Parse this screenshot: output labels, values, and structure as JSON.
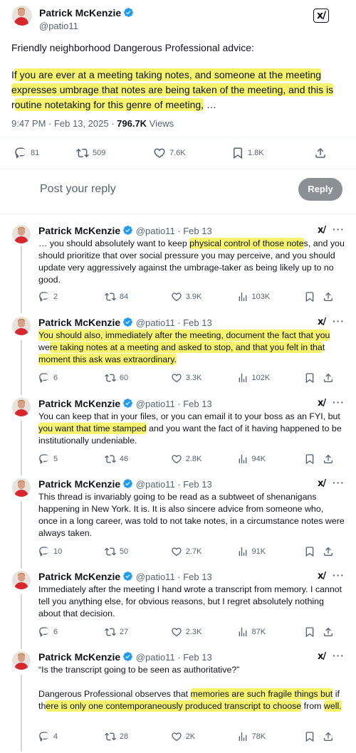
{
  "main": {
    "name": "Patrick McKenzie",
    "handle": "@patio11",
    "paragraph1": "Friendly neighborhood Dangerous Professional advice:",
    "p2_pre": "I",
    "p2_hl1": "f you are ever at a meeting taking notes, and someone at the meeting",
    "p2_hl2": "expresses umbrage that notes are being taken of the meeting, and this is",
    "p2_mid": "r",
    "p2_hl3": "outine notetaking for this genre of meeting,",
    "p2_post": " …",
    "time": "9:47 PM · Feb 13, 2025 · ",
    "views_count": "796.7K",
    "views_label": " Views",
    "stats": {
      "replies": "81",
      "reposts": "509",
      "likes": "7.6K",
      "bookmarks": "1.8K"
    }
  },
  "reply_box": {
    "prompt": "Post your reply",
    "button": "Reply"
  },
  "replies": [
    {
      "name": "Patrick McKenzie",
      "handle": "@patio11",
      "date": " · Feb 13",
      "t1": "… you should absolutely want to keep ",
      "h1": "physical control of those note",
      "t2": "s, and you should prioritize that over social pressure you may perceive, and you should update very aggressively against the umbrage-taker as being likely up to no good.",
      "replies": "2",
      "reposts": "84",
      "likes": "3.9K",
      "views": "103K"
    },
    {
      "name": "Patrick McKenzie",
      "handle": "@patio11",
      "date": " · Feb 13",
      "h1": "You should also, immediately after the meeting, document the fact that you",
      "t1": " we",
      "h2": "re taking notes at a meeting and asked to stop, and that you felt in tha",
      "t2": "t ",
      "h3": "moment this ask was extraordinary.",
      "replies": "6",
      "reposts": "60",
      "likes": "3.3K",
      "views": "102K"
    },
    {
      "name": "Patrick McKenzie",
      "handle": "@patio11",
      "date": " · Feb 13",
      "t1": "You can keep that in your files, or you can email it to your boss as an FYI, but ",
      "h1": "you want that time stamped",
      "t2": " and you want the fact of it having happened to be institutionally undeniable.",
      "replies": "5",
      "reposts": "46",
      "likes": "2.8K",
      "views": "94K"
    },
    {
      "name": "Patrick McKenzie",
      "handle": "@patio11",
      "date": " · Feb 13",
      "t1": "This thread is invariably going to be read as a subtweet of shenanigans happening in New York. It is. It is also sincere advice from someone who, once in a long career, was told to not take notes, in a circumstance notes were always taken.",
      "replies": "10",
      "reposts": "50",
      "likes": "2.7K",
      "views": "91K"
    },
    {
      "name": "Patrick McKenzie",
      "handle": "@patio11",
      "date": " · Feb 13",
      "t1": "Immediately after the meeting I hand wrote a transcript from memory. I cannot tell you anything else, for obvious reasons, but I regret absolutely nothing about that decision.",
      "replies": "6",
      "reposts": "27",
      "likes": "2.3K",
      "views": "87K"
    },
    {
      "name": "Patrick McKenzie",
      "handle": "@patio11",
      "date": " · Feb 13",
      "q": "“Is the transcript going to be seen as authoritative?”",
      "t1": "Dangerous Professional observes that ",
      "h1": "memories are such fragile things but",
      "t2": " if th",
      "h2": "ere is only one contemporaneously produced transcript to choose",
      "t3": " from ",
      "h3": "well.",
      "replies": "4",
      "reposts": "28",
      "likes": "2K",
      "views": "78K"
    }
  ]
}
